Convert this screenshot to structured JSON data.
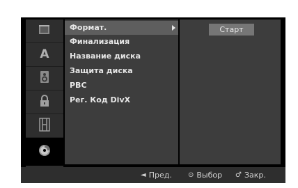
{
  "icons": [
    "movie-icon",
    "language-icon",
    "audio-icon",
    "lock-icon",
    "film-record-icon",
    "disc-icon"
  ],
  "menu": {
    "items": [
      {
        "label": "Формат.",
        "selected": true
      },
      {
        "label": "Финализация"
      },
      {
        "label": "Название диска"
      },
      {
        "label": "Защита диска"
      },
      {
        "label": "PBC"
      },
      {
        "label": "Рег. Код DivX"
      }
    ]
  },
  "right_panel": {
    "button": "Старт"
  },
  "footer": {
    "prev": "Пред.",
    "select": "Выбор",
    "close": "Закр."
  }
}
